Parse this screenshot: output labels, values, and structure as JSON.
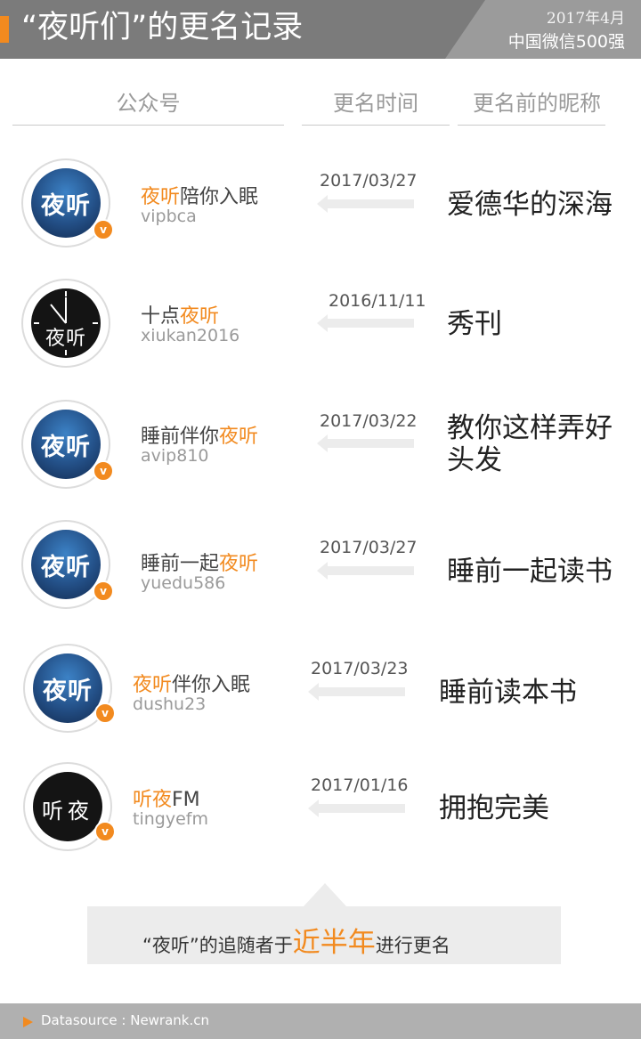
{
  "header": {
    "title": "“夜听们”的更名记录",
    "date": "2017年4月",
    "subtitle": "中国微信500强"
  },
  "columns": {
    "account": "公众号",
    "rename_time": "更名时间",
    "old_name": "更名前的昵称"
  },
  "rows": [
    {
      "name_pre": "",
      "name_hl": "夜听",
      "name_post": "陪你入眠",
      "id": "vipbca",
      "date": "2017/03/27",
      "old_name": "爱德华的深海",
      "logo": "夜听"
    },
    {
      "name_pre": "十点",
      "name_hl": "夜听",
      "name_post": "",
      "id": "xiukan2016",
      "date": "2016/11/11",
      "old_name": "秀刊",
      "logo": "夜听"
    },
    {
      "name_pre": "睡前伴你",
      "name_hl": "夜听",
      "name_post": "",
      "id": "avip810",
      "date": "2017/03/22",
      "old_name": "教你这样弄好头发",
      "logo": "夜听"
    },
    {
      "name_pre": "睡前一起",
      "name_hl": "夜听",
      "name_post": "",
      "id": "yuedu586",
      "date": "2017/03/27",
      "old_name": "睡前一起读书",
      "logo": "夜听"
    },
    {
      "name_pre": "",
      "name_hl": "夜听",
      "name_post": "伴你入眠",
      "id": "dushu23",
      "date": "2017/03/23",
      "old_name": "睡前读本书",
      "logo": "夜听"
    },
    {
      "name_pre": "",
      "name_hl": "听夜",
      "name_post": "FM",
      "id": "tingyefm",
      "date": "2017/01/16",
      "old_name": "拥抱完美",
      "logo": "听夜"
    }
  ],
  "note": {
    "pre": "“夜听”的追随者于",
    "highlight": "近半年",
    "post": "进行更名"
  },
  "footer": {
    "source": "Datasource : Newrank.cn"
  },
  "badge_letter": "v",
  "colors": {
    "accent": "#f28a1f",
    "header": "#7b7b7b",
    "footer": "#b0b0b0",
    "note_bg": "#ececec"
  }
}
